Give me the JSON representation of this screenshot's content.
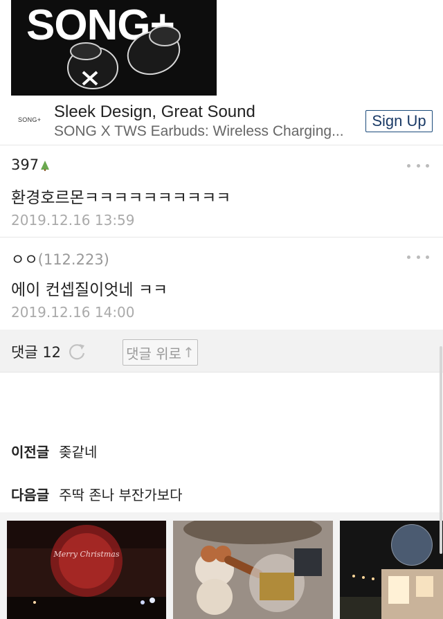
{
  "ad": {
    "banner_text": "SONG+",
    "logo_text": "SONG+",
    "title": "Sleek Design, Great Sound",
    "subtitle": "SONG X TWS Earbuds: Wireless Charging...",
    "signup_label": "Sign Up"
  },
  "comments": [
    {
      "author": "397",
      "ip": "",
      "text": "환경호르몬ㅋㅋㅋㅋㅋㅋㅋㅋㅋㅋ",
      "date": "2019.12.16 13:59"
    },
    {
      "author": "ㅇㅇ",
      "ip": "(112.223)",
      "text": "에이 컨셉질이엇네 ㅋㅋ",
      "date": "2019.12.16 14:00"
    }
  ],
  "comment_bar": {
    "label": "댓글 12",
    "to_top_label": "댓글 위로"
  },
  "nav": {
    "prev_key": "이전글",
    "prev_title": "좆같네",
    "next_key": "다음글",
    "next_title": "주딱 존나 부잔가보다"
  },
  "gallery": {
    "thumb1_text": "Merry Christmas"
  },
  "colors": {
    "accent": "#1a4a7a",
    "bar_bg": "#f2f2f2",
    "muted": "#aaaaaa"
  }
}
